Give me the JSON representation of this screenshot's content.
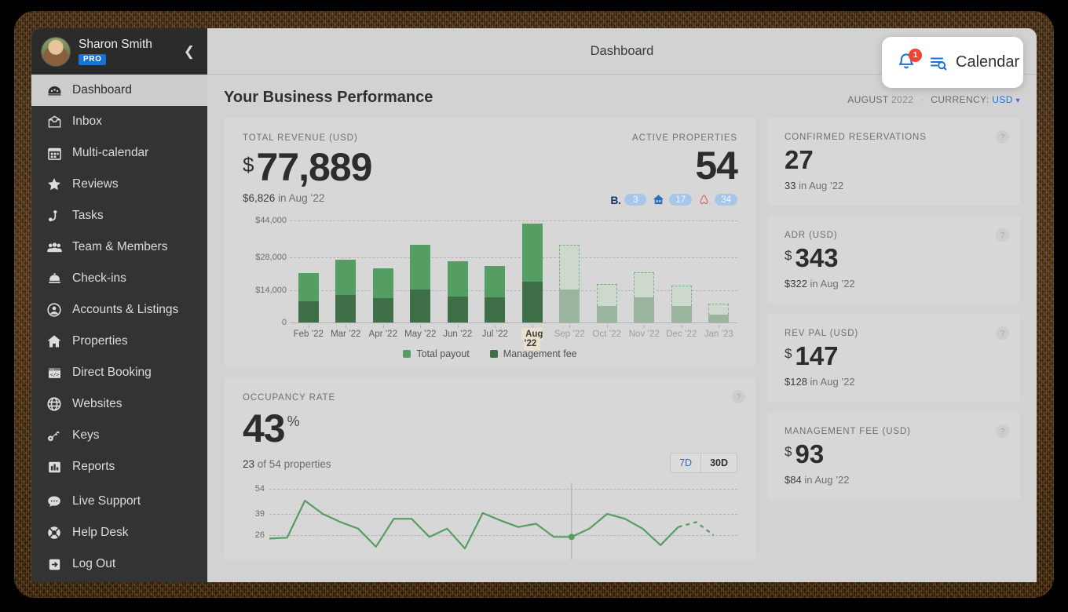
{
  "sidebar": {
    "user": {
      "name": "Sharon Smith",
      "badge": "PRO",
      "avatar_icon": "user-avatar"
    },
    "collapse_icon": "chevron-left-icon",
    "items": [
      {
        "label": "Dashboard",
        "icon": "dashboard-icon",
        "active": true
      },
      {
        "label": "Inbox",
        "icon": "inbox-icon",
        "active": false
      },
      {
        "label": "Multi-calendar",
        "icon": "calendar-icon",
        "active": false
      },
      {
        "label": "Reviews",
        "icon": "star-icon",
        "active": false
      },
      {
        "label": "Tasks",
        "icon": "vacuum-icon",
        "active": false
      },
      {
        "label": "Team & Members",
        "icon": "people-icon",
        "active": false
      },
      {
        "label": "Check-ins",
        "icon": "bell-desk-icon",
        "active": false
      },
      {
        "label": "Accounts & Listings",
        "icon": "account-circle-icon",
        "active": false
      },
      {
        "label": "Properties",
        "icon": "home-icon",
        "active": false
      },
      {
        "label": "Direct Booking",
        "icon": "code-window-icon",
        "active": false
      },
      {
        "label": "Websites",
        "icon": "globe-icon",
        "active": false
      },
      {
        "label": "Keys",
        "icon": "key-icon",
        "active": false
      },
      {
        "label": "Reports",
        "icon": "bar-chart-icon",
        "active": false
      },
      {
        "label": "Live Support",
        "icon": "chat-bubble-icon",
        "active": false
      },
      {
        "label": "Help Desk",
        "icon": "lifebuoy-icon",
        "active": false
      },
      {
        "label": "Log Out",
        "icon": "logout-icon",
        "active": false
      }
    ]
  },
  "topbar": {
    "title": "Dashboard",
    "popup": {
      "notification_icon": "bell-icon",
      "notification_count": "1",
      "calendar_search_icon": "calendar-search-icon",
      "calendar_label": "Calendar"
    },
    "cursor_icon": "pointing-hand-cursor"
  },
  "content": {
    "page_title": "Your Business Performance",
    "meta": {
      "month": "AUGUST",
      "year": "2022",
      "separator": "·",
      "currency_label": "CURRENCY:",
      "currency_value": "USD",
      "currency_caret_icon": "chevron-down-icon"
    },
    "revenue_card": {
      "label": "TOTAL REVENUE (USD)",
      "currency_symbol": "$",
      "value": "77,889",
      "sub_value": "$6,826",
      "sub_text": "in Aug ’22",
      "active_properties_label": "ACTIVE PROPERTIES",
      "active_properties_value": "54",
      "channels": [
        {
          "icon": "booking-com-icon",
          "mark": "B.",
          "count": "3"
        },
        {
          "icon": "vrbo-house-icon",
          "mark": "",
          "count": "17"
        },
        {
          "icon": "airbnb-icon",
          "mark": "",
          "count": "34"
        }
      ]
    },
    "occupancy_card": {
      "label": "OCCUPANCY RATE",
      "value": "43",
      "percent_symbol": "%",
      "sub_value": "23",
      "sub_text": "of 54 properties",
      "help_icon": "question-mark-icon",
      "range_options": [
        {
          "label": "7D",
          "active": false
        },
        {
          "label": "30D",
          "active": true
        }
      ]
    },
    "kpis": [
      {
        "label": "CONFIRMED RESERVATIONS",
        "currency_symbol": "",
        "value": "27",
        "sub_value": "33",
        "sub_text": "in Aug ’22",
        "help_icon": "question-mark-icon"
      },
      {
        "label": "ADR (USD)",
        "currency_symbol": "$",
        "value": "343",
        "sub_value": "$322",
        "sub_text": "in Aug  ’22",
        "help_icon": "question-mark-icon"
      },
      {
        "label": "REV PAL (USD)",
        "currency_symbol": "$",
        "value": "147",
        "sub_value": "$128",
        "sub_text": "in Aug ’22",
        "help_icon": "question-mark-icon"
      },
      {
        "label": "MANAGEMENT FEE (USD)",
        "currency_symbol": "$",
        "value": "93",
        "sub_value": "$84",
        "sub_text": "in Aug ’22",
        "help_icon": "question-mark-icon"
      }
    ]
  },
  "colors": {
    "accent_blue": "#1a73d4",
    "payout_green": "#549e63",
    "fee_green": "#3f6f48",
    "projected_payout": "#cdd9cd",
    "projected_fee": "#9bb49e",
    "badge_red": "#f34136",
    "sidebar_bg": "#333333",
    "card_bg": "#d7d7d7",
    "highlight_beige": "#e8e2cd"
  },
  "chart_data": [
    {
      "type": "bar",
      "id": "total-revenue-bar-chart",
      "title": "TOTAL REVENUE (USD)",
      "stacked": true,
      "categories": [
        "Feb ’22",
        "Mar ’22",
        "Apr ’22",
        "May ’22",
        "Jun ’22",
        "Jul ’22",
        "Aug ’22",
        "Sep ’22",
        "Oct ’22",
        "Nov ’22",
        "Dec ’22",
        "Jan ’23"
      ],
      "series": [
        {
          "name": "Management fee",
          "values": [
            9200,
            11800,
            10600,
            14200,
            11300,
            11000,
            17600,
            14200,
            7200,
            10800,
            7000,
            3400
          ]
        },
        {
          "name": "Total payout",
          "values": [
            12200,
            15200,
            12600,
            19300,
            15000,
            13400,
            25000,
            19400,
            9500,
            10900,
            9000,
            4600
          ]
        }
      ],
      "totals": [
        21400,
        27000,
        23200,
        33500,
        26300,
        24400,
        42600,
        33600,
        16700,
        21700,
        16000,
        8000
      ],
      "projected_from": "Sep ’22",
      "highlighted_category": "Aug ’22",
      "ylabel": "",
      "xlabel": "",
      "ytick_labels": [
        "0",
        "$14,000",
        "$28,000",
        "$44,000"
      ],
      "ytick_values": [
        0,
        14000,
        28000,
        44000
      ],
      "ylim": [
        0,
        44000
      ],
      "grid": true,
      "legend": [
        "Total payout",
        "Management fee"
      ],
      "legend_position": "bottom"
    },
    {
      "type": "line",
      "id": "occupancy-rate-line-chart",
      "title": "OCCUPANCY RATE",
      "ytick_labels": [
        "26",
        "39",
        "54"
      ],
      "ytick_values": [
        26,
        39,
        54
      ],
      "ylim": [
        18,
        58
      ],
      "grid": true,
      "series": [
        {
          "name": "Occupancy",
          "values": [
            24,
            24.5,
            47,
            39,
            34,
            30,
            19,
            36,
            36,
            25,
            30,
            18,
            39.5,
            35,
            31,
            33,
            25,
            25,
            30,
            39,
            36,
            30,
            20,
            31,
            34,
            26
          ],
          "projected_from_index": 23
        }
      ],
      "marker_index": 17,
      "legend": [],
      "legend_position": "none"
    }
  ]
}
